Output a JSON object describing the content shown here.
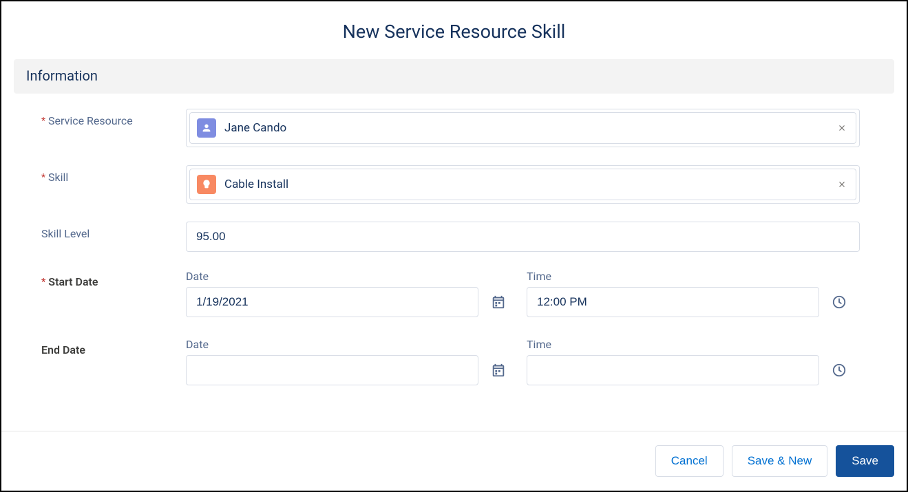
{
  "modal": {
    "title": "New Service Resource Skill"
  },
  "section": {
    "title": "Information"
  },
  "fields": {
    "service_resource": {
      "label": "Service Resource",
      "required": true,
      "value": "Jane Cando",
      "icon_bg": "#7f8de1"
    },
    "skill": {
      "label": "Skill",
      "required": true,
      "value": "Cable Install",
      "icon_bg": "#f88962"
    },
    "skill_level": {
      "label": "Skill Level",
      "required": false,
      "value": "95.00"
    },
    "start_date": {
      "label": "Start Date",
      "required": true,
      "date_label": "Date",
      "date_value": "1/19/2021",
      "time_label": "Time",
      "time_value": "12:00 PM"
    },
    "end_date": {
      "label": "End Date",
      "required": false,
      "date_label": "Date",
      "date_value": "",
      "time_label": "Time",
      "time_value": ""
    }
  },
  "footer": {
    "cancel": "Cancel",
    "save_new": "Save & New",
    "save": "Save"
  }
}
